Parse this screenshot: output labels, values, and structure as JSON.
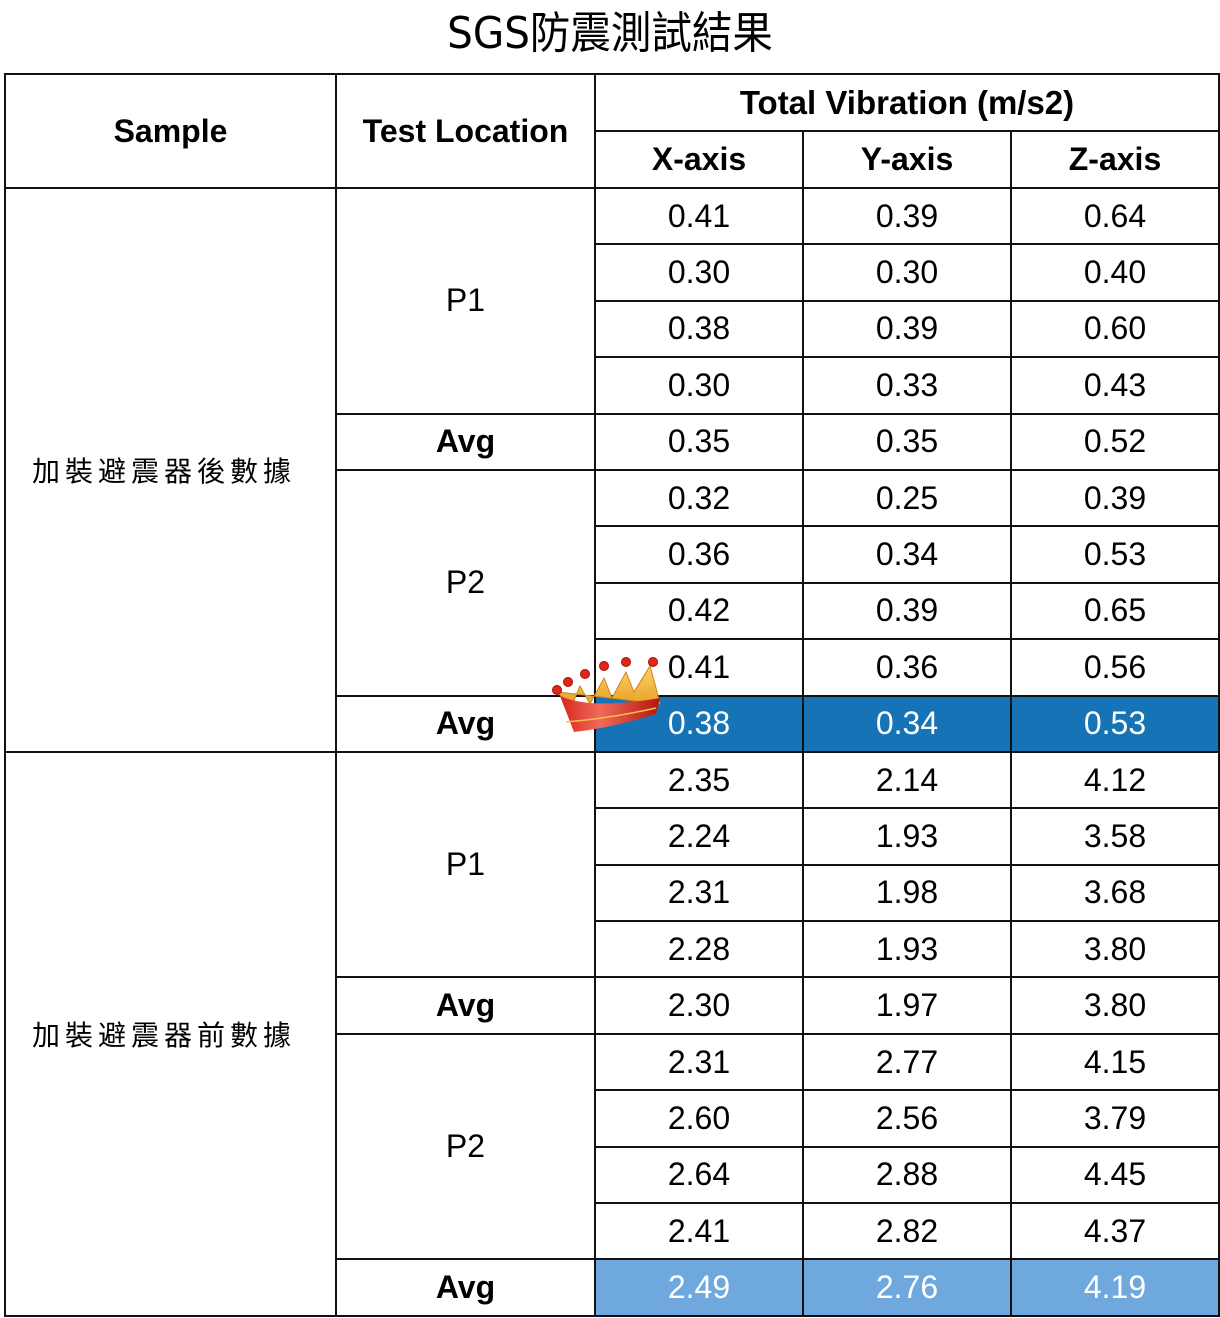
{
  "title": "SGS防震測試結果",
  "header": {
    "sample": "Sample",
    "test_location": "Test Location",
    "group": "Total Vibration (m/s2)",
    "axes": [
      "X-axis",
      "Y-axis",
      "Z-axis"
    ]
  },
  "highlight_colors": {
    "after_avg": "#1674b6",
    "before_avg": "#6fa8dc"
  },
  "groups": [
    {
      "sample": "加裝避震器後數據",
      "locations": [
        {
          "name": "P1",
          "rows": [
            [
              "0.41",
              "0.39",
              "0.64"
            ],
            [
              "0.30",
              "0.30",
              "0.40"
            ],
            [
              "0.38",
              "0.39",
              "0.60"
            ],
            [
              "0.30",
              "0.33",
              "0.43"
            ]
          ],
          "avg_label": "Avg",
          "avg": [
            "0.35",
            "0.35",
            "0.52"
          ]
        },
        {
          "name": "P2",
          "rows": [
            [
              "0.32",
              "0.25",
              "0.39"
            ],
            [
              "0.36",
              "0.34",
              "0.53"
            ],
            [
              "0.42",
              "0.39",
              "0.65"
            ],
            [
              "0.41",
              "0.36",
              "0.56"
            ]
          ],
          "avg_label": "Avg",
          "avg": [
            "0.38",
            "0.34",
            "0.53"
          ]
        }
      ]
    },
    {
      "sample": "加裝避震器前數據",
      "locations": [
        {
          "name": "P1",
          "rows": [
            [
              "2.35",
              "2.14",
              "4.12"
            ],
            [
              "2.24",
              "1.93",
              "3.58"
            ],
            [
              "2.31",
              "1.98",
              "3.68"
            ],
            [
              "2.28",
              "1.93",
              "3.80"
            ]
          ],
          "avg_label": "Avg",
          "avg": [
            "2.30",
            "1.97",
            "3.80"
          ]
        },
        {
          "name": "P2",
          "rows": [
            [
              "2.31",
              "2.77",
              "4.15"
            ],
            [
              "2.60",
              "2.56",
              "3.79"
            ],
            [
              "2.64",
              "2.88",
              "4.45"
            ],
            [
              "2.41",
              "2.82",
              "4.37"
            ]
          ],
          "avg_label": "Avg",
          "avg": [
            "2.49",
            "2.76",
            "4.19"
          ]
        }
      ]
    }
  ],
  "decoration": {
    "icon": "crown-icon"
  }
}
